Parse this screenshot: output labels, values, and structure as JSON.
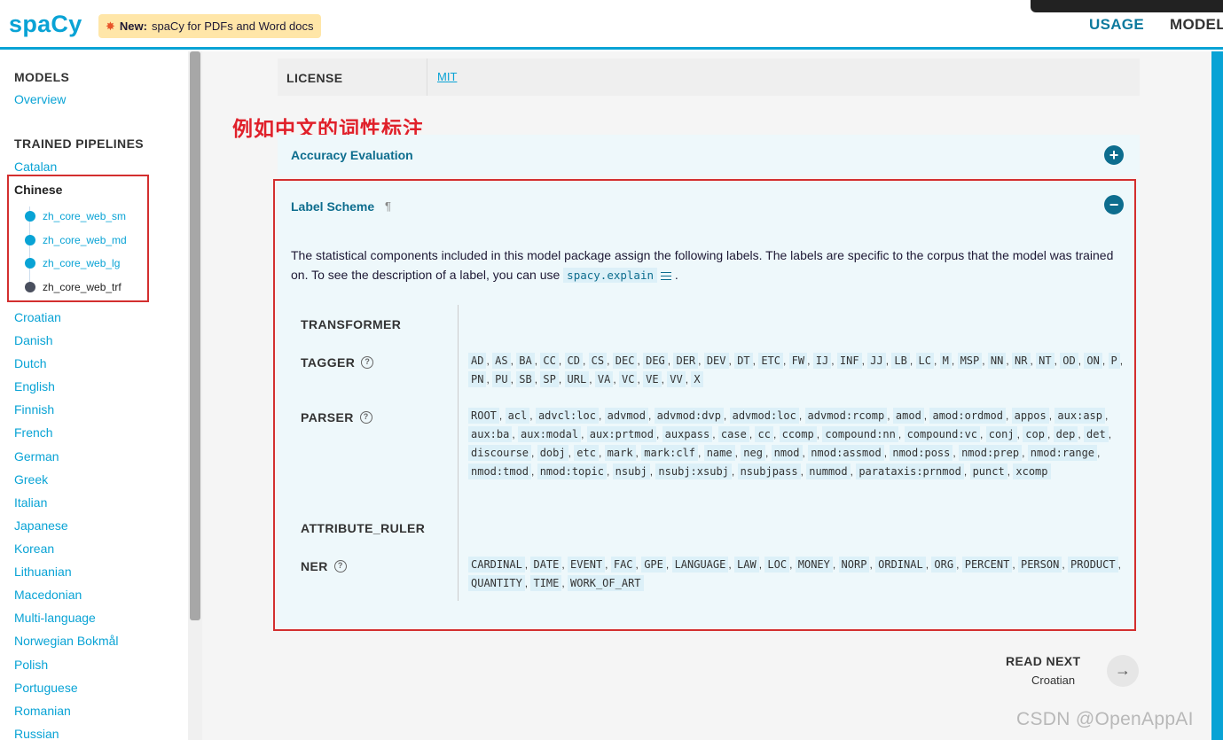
{
  "header": {
    "logo": "spaCy",
    "news_bold": "New:",
    "news_text": "spaCy for PDFs and Word docs",
    "nav_usage": "USAGE",
    "nav_models": "MODELS"
  },
  "sidebar": {
    "models_heading": "MODELS",
    "overview": "Overview",
    "pipelines_heading": "TRAINED PIPELINES",
    "catalan": "Catalan",
    "chinese": "Chinese",
    "chinese_models": [
      "zh_core_web_sm",
      "zh_core_web_md",
      "zh_core_web_lg",
      "zh_core_web_trf"
    ],
    "languages": [
      "Croatian",
      "Danish",
      "Dutch",
      "English",
      "Finnish",
      "French",
      "German",
      "Greek",
      "Italian",
      "Japanese",
      "Korean",
      "Lithuanian",
      "Macedonian",
      "Multi-language",
      "Norwegian Bokmål",
      "Polish",
      "Portuguese",
      "Romanian",
      "Russian"
    ]
  },
  "license": {
    "key": "LICENSE",
    "value": "MIT"
  },
  "annotation": "例如中文的词性标注",
  "accuracy": {
    "title": "Accuracy Evaluation",
    "icon": "+"
  },
  "label_scheme": {
    "title": "Label Scheme",
    "pilcrow": "¶",
    "icon": "−",
    "para_before": "The statistical components included in this model package assign the following labels. The labels are specific to the corpus that the model was trained on. To see the description of a label, you can use",
    "code": "spacy.explain",
    "para_after": ".",
    "components": {
      "transformer": "TRANSFORMER",
      "tagger": "TAGGER",
      "parser": "PARSER",
      "attribute_ruler": "ATTRIBUTE_RULER",
      "ner": "NER"
    },
    "tagger_labels": [
      "AD",
      "AS",
      "BA",
      "CC",
      "CD",
      "CS",
      "DEC",
      "DEG",
      "DER",
      "DEV",
      "DT",
      "ETC",
      "FW",
      "IJ",
      "INF",
      "JJ",
      "LB",
      "LC",
      "M",
      "MSP",
      "NN",
      "NR",
      "NT",
      "OD",
      "ON",
      "P",
      "PN",
      "PU",
      "SB",
      "SP",
      "URL",
      "VA",
      "VC",
      "VE",
      "VV",
      "X"
    ],
    "parser_labels": [
      "ROOT",
      "acl",
      "advcl:loc",
      "advmod",
      "advmod:dvp",
      "advmod:loc",
      "advmod:rcomp",
      "amod",
      "amod:ordmod",
      "appos",
      "aux:asp",
      "aux:ba",
      "aux:modal",
      "aux:prtmod",
      "auxpass",
      "case",
      "cc",
      "ccomp",
      "compound:nn",
      "compound:vc",
      "conj",
      "cop",
      "dep",
      "det",
      "discourse",
      "dobj",
      "etc",
      "mark",
      "mark:clf",
      "name",
      "neg",
      "nmod",
      "nmod:assmod",
      "nmod:poss",
      "nmod:prep",
      "nmod:range",
      "nmod:tmod",
      "nmod:topic",
      "nsubj",
      "nsubj:xsubj",
      "nsubjpass",
      "nummod",
      "parataxis:prnmod",
      "punct",
      "xcomp"
    ],
    "ner_labels": [
      "CARDINAL",
      "DATE",
      "EVENT",
      "FAC",
      "GPE",
      "LANGUAGE",
      "LAW",
      "LOC",
      "MONEY",
      "NORP",
      "ORDINAL",
      "ORG",
      "PERCENT",
      "PERSON",
      "PRODUCT",
      "QUANTITY",
      "TIME",
      "WORK_OF_ART"
    ]
  },
  "read_next": {
    "label": "READ NEXT",
    "target": "Croatian",
    "arrow": "→"
  },
  "watermark": "CSDN @OpenAppAI",
  "colors": {
    "accent": "#09a3d5",
    "accent_dark": "#0d6d8e",
    "highlight_box": "#d32f2f",
    "annotation": "#e0202a",
    "news_bg": "#ffe6a8"
  }
}
